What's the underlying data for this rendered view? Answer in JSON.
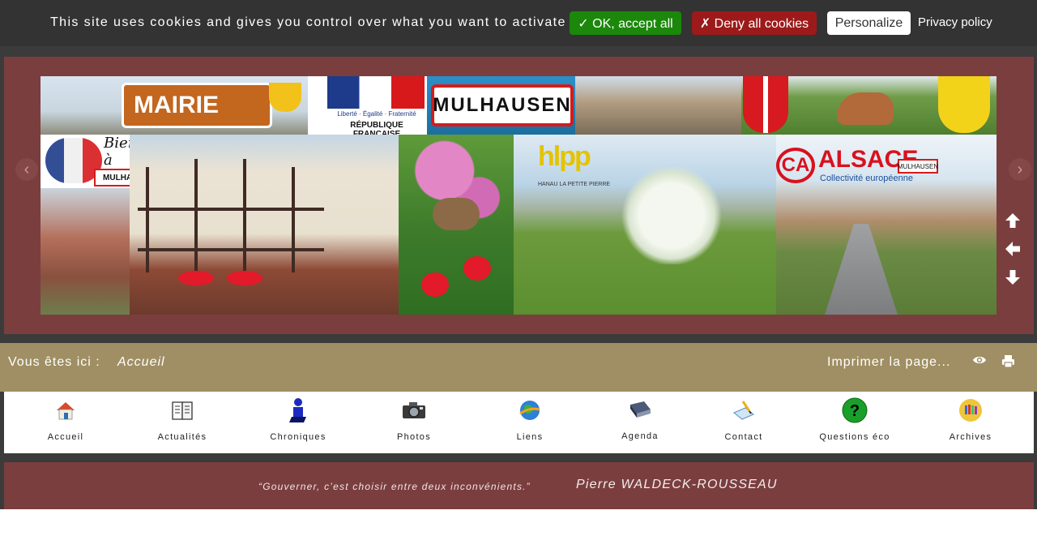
{
  "cookie_bar": {
    "message": "This site uses cookies and gives you control over what you want to activate",
    "accept_label": "✓ OK, accept all",
    "deny_label": "✗ Deny all cookies",
    "personalize_label": "Personalize",
    "privacy_label": "Privacy policy",
    "accept_color": "#1b870b",
    "deny_color": "#9c1a1a"
  },
  "banner": {
    "mairie_sign": "MAIRIE",
    "rf_motto": "Liberté · Égalité · Fraternité",
    "rf_name": "RÉPUBLIQUE FRANÇAISE",
    "town_sign": "MULHAUSEN",
    "welcome_text": "Bienvenue à",
    "welcome_sign": "MULHAUSEN",
    "hlpp_logo": "hlpp",
    "hlpp_sub": "HANAU LA PETITE PIERRE",
    "ca_logo": "CA",
    "alsace_title": "ALSACE",
    "alsace_subtitle": "Collectivité européenne",
    "road_sign": "MULHAUSEN",
    "prev_icon": "chevron-left-icon",
    "next_icon": "chevron-right-icon",
    "up_icon": "arrow-up-icon",
    "left_icon": "arrow-left-icon",
    "down_icon": "arrow-down-icon"
  },
  "breadcrumb": {
    "label": "Vous êtes ici :",
    "current": "Accueil",
    "print_label": "Imprimer la page..."
  },
  "menu": {
    "items": [
      {
        "label": "Accueil",
        "icon": "home-icon"
      },
      {
        "label": "Actualités",
        "icon": "newspaper-icon"
      },
      {
        "label": "Chroniques",
        "icon": "person-icon"
      },
      {
        "label": "Photos",
        "icon": "camera-icon"
      },
      {
        "label": "Liens",
        "icon": "globe-icon"
      },
      {
        "label": "Agenda",
        "icon": "book-icon"
      },
      {
        "label": "Contact",
        "icon": "write-icon"
      },
      {
        "label": "Questions éco",
        "icon": "question-icon"
      },
      {
        "label": "Archives",
        "icon": "archive-icon"
      }
    ]
  },
  "quote": {
    "text": "“Gouverner, c’est choisir entre deux inconvénients.”",
    "author": "Pierre WALDECK-ROUSSEAU"
  },
  "colors": {
    "frame": "#7b3e3f",
    "breadcrumb_bg": "#a08f64",
    "cookie_bg": "#333333"
  }
}
